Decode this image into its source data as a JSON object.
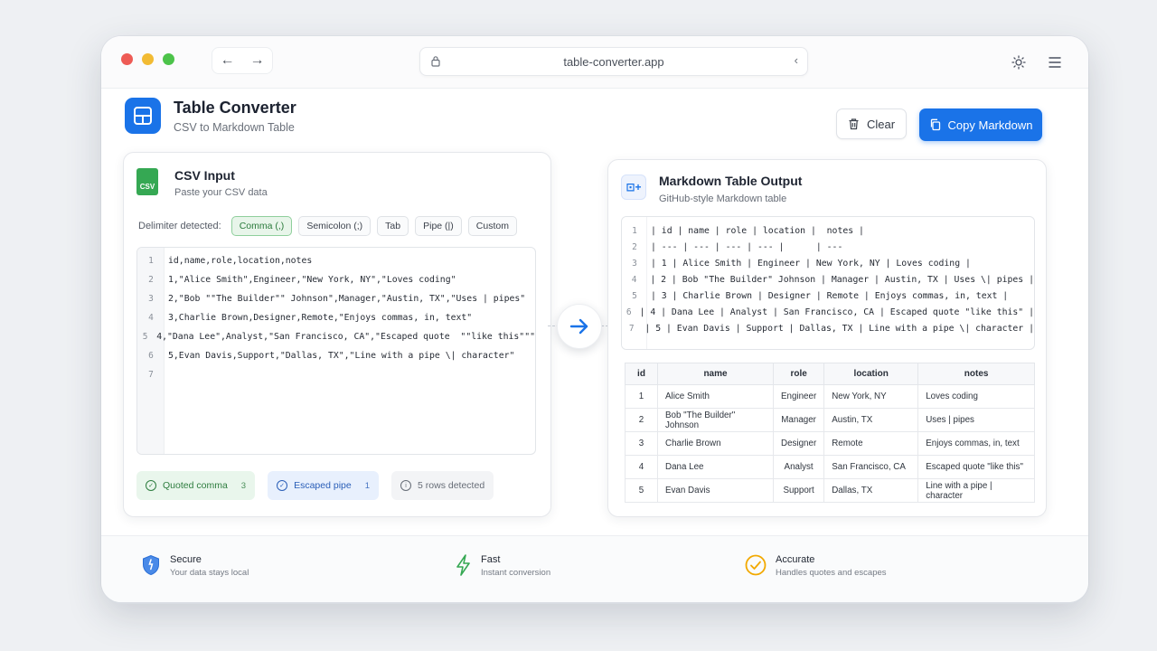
{
  "browser": {
    "url": "table-converter.app",
    "back_label": "←",
    "forward_label": "→",
    "reload_label": "‹"
  },
  "app": {
    "title": "Table Converter",
    "subtitle": "CSV to Markdown Table"
  },
  "toolbar": {
    "clear_label": "Clear",
    "copy_label": "Copy Markdown"
  },
  "input_panel": {
    "title": "CSV Input",
    "subtitle": "Paste your CSV data",
    "file_badge": "CSV",
    "delimiter_label": "Delimiter detected:",
    "delimiters": [
      "Comma (,)",
      "Semicolon (;)",
      "Tab",
      "Pipe (|)",
      "Custom"
    ],
    "selected_delimiter": "Comma (,)",
    "lines": [
      "id,name,role,location,notes",
      "1,\"Alice Smith\",Engineer,\"New York, NY\",\"Loves coding\"",
      "2,\"Bob \"\"The Builder\"\" Johnson\",Manager,\"Austin, TX\",\"Uses | pipes\"",
      "3,Charlie Brown,Designer,Remote,\"Enjoys commas, in, text\"",
      "4,\"Dana Lee\",Analyst,\"San Francisco, CA\",\"Escaped quote  \"\"like this\"\"\"",
      "5,Evan Davis,Support,\"Dallas, TX\",\"Line with a pipe \\| character\"",
      ""
    ],
    "line_numbers": [
      "1",
      "2",
      "3",
      "4",
      "5",
      "6",
      "7"
    ],
    "status": {
      "quoted_comma": {
        "label": "Quoted comma",
        "count": "3"
      },
      "escaped_pipe": {
        "label": "Escaped pipe",
        "count": "1"
      },
      "rows": {
        "label": "5 rows detected"
      }
    }
  },
  "output_panel": {
    "title": "Markdown Table Output",
    "subtitle": "GitHub-style Markdown table",
    "icon_text": "⊡+",
    "line_numbers": [
      "1",
      "2",
      "3",
      "4",
      "5",
      "6",
      "7"
    ],
    "markdown_lines": [
      "| id | name | role | location |  notes |",
      "| --- | --- | --- | --- |      | ---",
      "| 1 | Alice Smith | Engineer | New York, NY | Loves coding |",
      "| 2 | Bob \"The Builder\" Johnson | Manager | Austin, TX | Uses \\| pipes |",
      "| 3 | Charlie Brown | Designer | Remote | Enjoys commas, in, text |",
      "| 4 | Dana Lee | Analyst | San Francisco, CA | Escaped quote \"like this\" |",
      "| 5 | Evan Davis | Support | Dallas, TX | Line with a pipe \\| character |"
    ],
    "table": {
      "headers": [
        "id",
        "name",
        "role",
        "location",
        "notes"
      ],
      "rows": [
        [
          "1",
          "Alice Smith",
          "Engineer",
          "New York, NY",
          "Loves coding"
        ],
        [
          "2",
          "Bob \"The Builder\" Johnson",
          "Manager",
          "Austin, TX",
          "Uses | pipes"
        ],
        [
          "3",
          "Charlie Brown",
          "Designer",
          "Remote",
          "Enjoys commas, in, text"
        ],
        [
          "4",
          "Dana Lee",
          "Analyst",
          "San Francisco, CA",
          "Escaped quote \"like this\""
        ],
        [
          "5",
          "Evan Davis",
          "Support",
          "Dallas, TX",
          "Line with a pipe | character"
        ]
      ]
    }
  },
  "footer": {
    "features": [
      {
        "title": "Secure",
        "subtitle": "Your data stays local",
        "icon": "shield-icon"
      },
      {
        "title": "Fast",
        "subtitle": "Instant conversion",
        "icon": "bolt-icon"
      },
      {
        "title": "Accurate",
        "subtitle": "Handles quotes and escapes",
        "icon": "check-circle-icon"
      }
    ]
  },
  "colors": {
    "accent": "#1a73e8",
    "success": "#35a853",
    "warning": "#f2a900"
  }
}
